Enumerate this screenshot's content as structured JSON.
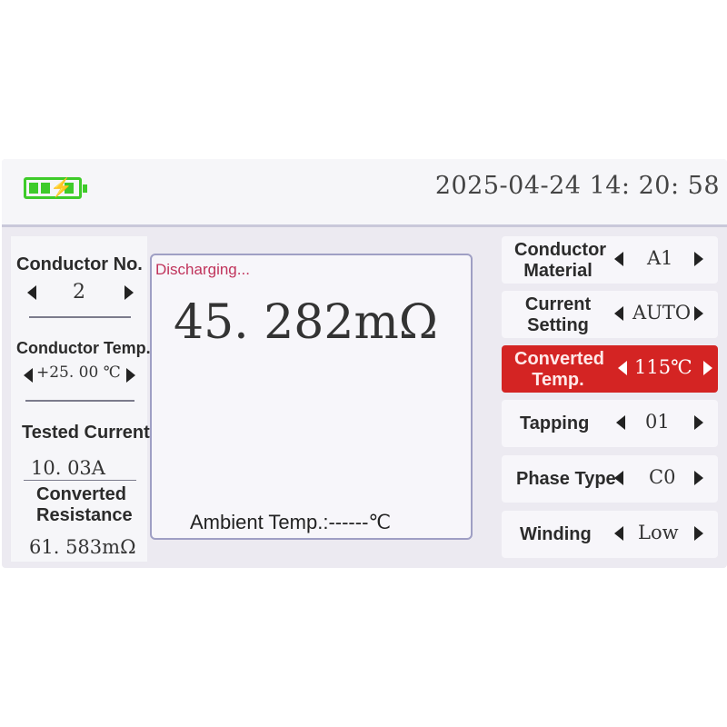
{
  "header": {
    "datetime": "2025-04-24 14: 20: 58",
    "battery_icon": "battery-charging-icon"
  },
  "left": {
    "conductor_no_label": "Conductor No.",
    "conductor_no_value": "2",
    "conductor_temp_label": "Conductor Temp.",
    "conductor_temp_value": "+25. 00 ℃",
    "tested_current_label": "Tested Current",
    "tested_current_value": "10. 03A",
    "converted_resistance_label_1": "Converted",
    "converted_resistance_label_2": "Resistance",
    "converted_resistance_value": "61. 583mΩ"
  },
  "main": {
    "status": "Discharging...",
    "reading": "45. 282mΩ",
    "ambient": "Ambient Temp.:------℃"
  },
  "settings": [
    {
      "label_1": "Conductor",
      "label_2": "Material",
      "value": "A1"
    },
    {
      "label_1": "Current",
      "label_2": "Setting",
      "value": "AUTO"
    },
    {
      "label_1": "Converted",
      "label_2": "Temp.",
      "value": "115℃"
    },
    {
      "label_1": "Tapping",
      "value": "01"
    },
    {
      "label_1": "Phase Type",
      "value": "C0"
    },
    {
      "label_1": "Winding",
      "value": "Low"
    }
  ],
  "colors": {
    "accent_active": "#d42423",
    "battery": "#3ecb2a",
    "status_text": "#c0335b"
  }
}
